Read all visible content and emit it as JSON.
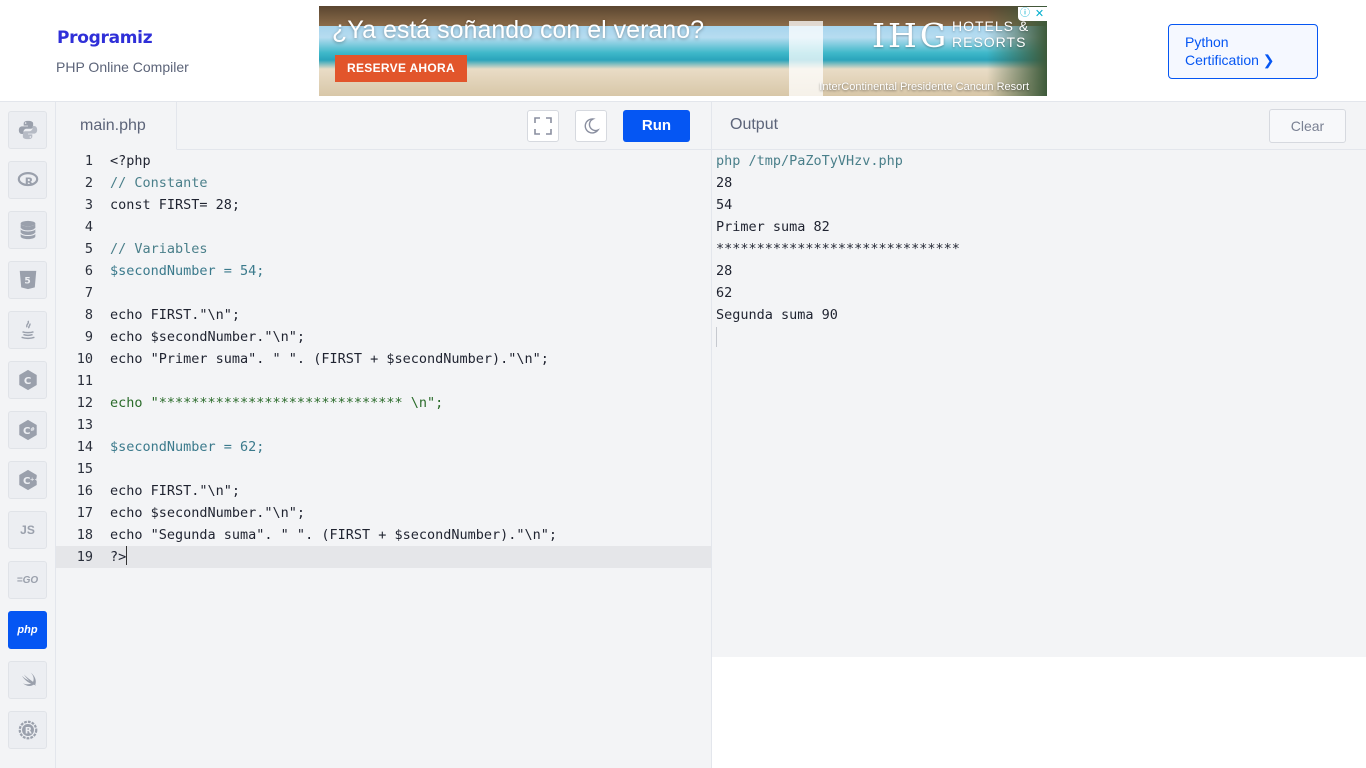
{
  "header": {
    "logo": "Programiz",
    "subtitle": "PHP Online Compiler",
    "cert_button": {
      "line1": "Python",
      "line2": "Certification ❯"
    }
  },
  "ad": {
    "headline": "¿Ya está soñando con el verano?",
    "brand": "IHG",
    "brand_sub1": "HOTELS &",
    "brand_sub2": "RESORTS",
    "cta": "RESERVE AHORA",
    "location": "InterContinental Presidente Cancun Resort",
    "info_icon": "ⓘ",
    "close_icon": "✕"
  },
  "sidebar": {
    "languages": [
      {
        "name": "python",
        "label": ""
      },
      {
        "name": "r",
        "label": "R"
      },
      {
        "name": "sql",
        "label": ""
      },
      {
        "name": "html",
        "label": "5"
      },
      {
        "name": "java",
        "label": ""
      },
      {
        "name": "c",
        "label": "C"
      },
      {
        "name": "csharp",
        "label": "C"
      },
      {
        "name": "cpp",
        "label": "C"
      },
      {
        "name": "javascript",
        "label": "JS"
      },
      {
        "name": "go",
        "label": "GO"
      },
      {
        "name": "php",
        "label": "php",
        "active": true
      },
      {
        "name": "swift",
        "label": ""
      },
      {
        "name": "rust",
        "label": "R"
      }
    ]
  },
  "editor": {
    "file_tab": "main.php",
    "run_label": "Run",
    "lines": [
      {
        "n": "1",
        "code": "<?php"
      },
      {
        "n": "2",
        "code": "// Constante"
      },
      {
        "n": "3",
        "code": "const FIRST= 28;"
      },
      {
        "n": "4",
        "code": ""
      },
      {
        "n": "5",
        "code": "// Variables"
      },
      {
        "n": "6",
        "code": "$secondNumber = 54;"
      },
      {
        "n": "7",
        "code": ""
      },
      {
        "n": "8",
        "code": "echo FIRST.\"\\n\";"
      },
      {
        "n": "9",
        "code": "echo $secondNumber.\"\\n\";"
      },
      {
        "n": "10",
        "code": "echo \"Primer suma\". \" \". (FIRST + $secondNumber).\"\\n\";"
      },
      {
        "n": "11",
        "code": ""
      },
      {
        "n": "12",
        "code": "echo \"****************************** \\n\";"
      },
      {
        "n": "13",
        "code": ""
      },
      {
        "n": "14",
        "code": "$secondNumber = 62;"
      },
      {
        "n": "15",
        "code": ""
      },
      {
        "n": "16",
        "code": "echo FIRST.\"\\n\";"
      },
      {
        "n": "17",
        "code": "echo $secondNumber.\"\\n\";"
      },
      {
        "n": "18",
        "code": "echo \"Segunda suma\". \" \". (FIRST + $secondNumber).\"\\n\";"
      },
      {
        "n": "19",
        "code": "?>"
      }
    ]
  },
  "output": {
    "title": "Output",
    "clear_label": "Clear",
    "command": "php /tmp/PaZoTyVHzv.php",
    "lines": [
      "28",
      "54",
      "Primer suma 82",
      "******************************",
      "28",
      "62",
      "Segunda suma 90"
    ]
  },
  "colors": {
    "accent": "#0556f3",
    "panel_bg": "#f3f4f6"
  }
}
